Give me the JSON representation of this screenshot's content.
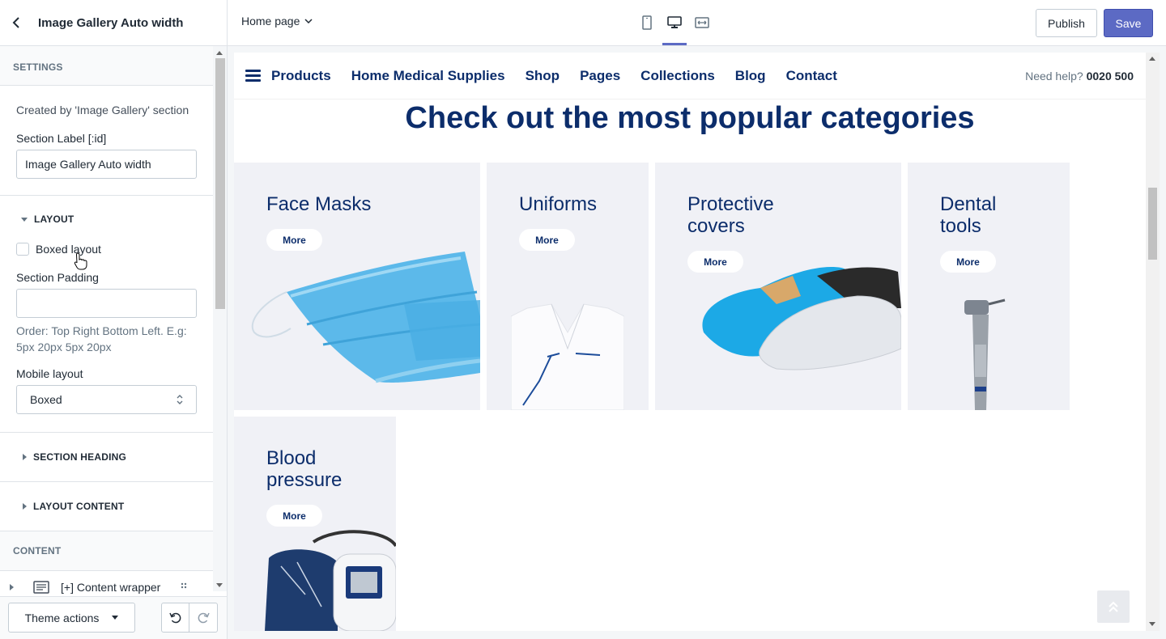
{
  "topbar": {
    "section_title": "Image Gallery Auto width",
    "page_select": "Home page",
    "publish_label": "Publish",
    "save_label": "Save"
  },
  "sidebar": {
    "settings_header": "SETTINGS",
    "created_by": "Created by 'Image Gallery' section",
    "section_label_title": "Section Label [:id]",
    "section_label_value": "Image Gallery Auto width",
    "layout_header": "LAYOUT",
    "boxed_layout_label": "Boxed layout",
    "section_padding_label": "Section Padding",
    "section_padding_value": "",
    "padding_help": "Order: Top Right Bottom Left. E.g: 5px 20px 5px 20px",
    "mobile_layout_label": "Mobile layout",
    "mobile_layout_value": "Boxed",
    "section_heading_header": "SECTION HEADING",
    "layout_content_header": "LAYOUT CONTENT",
    "content_header": "CONTENT",
    "content_item": "[+] Content wrapper",
    "theme_actions_label": "Theme actions"
  },
  "preview": {
    "nav_items": [
      "Products",
      "Home Medical Supplies",
      "Shop",
      "Pages",
      "Collections",
      "Blog",
      "Contact"
    ],
    "need_help_label": "Need help?",
    "need_help_phone": "0020 500",
    "heading": "Check out the most popular categories",
    "cards": [
      {
        "title_line1": "Face Masks",
        "title_line2": "",
        "button": "More",
        "image": "face-mask"
      },
      {
        "title_line1": "Uniforms",
        "title_line2": "",
        "button": "More",
        "image": "uniform"
      },
      {
        "title_line1": "Protective",
        "title_line2": "covers",
        "button": "More",
        "image": "shoe-covers"
      },
      {
        "title_line1": "Dental",
        "title_line2": "tools",
        "button": "More",
        "image": "dental-tool"
      },
      {
        "title_line1": "Blood",
        "title_line2": "pressure",
        "button": "More",
        "image": "blood-pressure-monitor"
      }
    ]
  },
  "colors": {
    "accent": "#5c6ac4",
    "navy": "#0c2d6b",
    "card_bg": "#f0f1f6"
  }
}
